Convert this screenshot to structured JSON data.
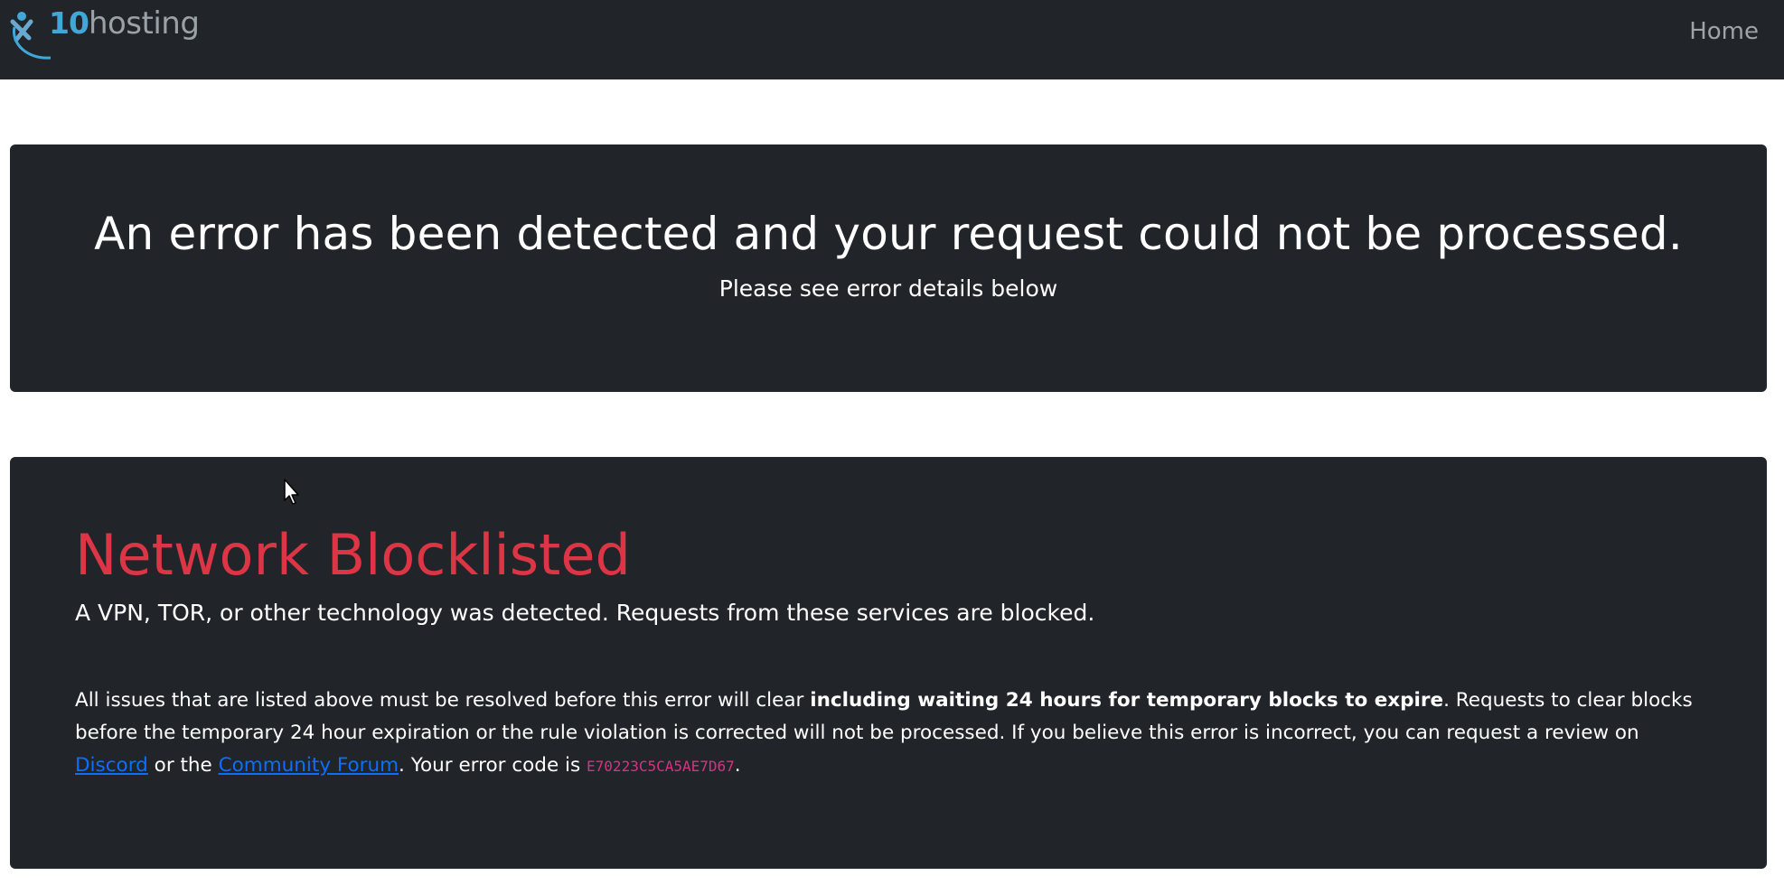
{
  "navbar": {
    "logo": {
      "num": "10",
      "word": "hosting",
      "colors": {
        "mark": "#41a7d9",
        "word": "#9aa1a7"
      }
    },
    "home_label": "Home"
  },
  "error_header": {
    "title": "An error has been detected and your request could not be processed.",
    "subtitle": "Please see error details below"
  },
  "error_detail": {
    "heading": "Network Blocklisted",
    "lead": "A VPN, TOR, or other technology was detected. Requests from these services are blocked.",
    "body_part1": "All issues that are listed above must be resolved before this error will clear ",
    "body_bold": "including waiting 24 hours for temporary blocks to expire",
    "body_part2": ". Requests to clear blocks before the temporary 24 hour expiration or the rule violation is corrected will not be processed. If you believe this error is incorrect, you can request a review on ",
    "discord_link": "Discord",
    "body_part3": " or the ",
    "forum_link": "Community Forum",
    "body_part4": ". Your error code is ",
    "error_code": "E70223C5CA5AE7D67",
    "body_part5": "."
  },
  "colors": {
    "dark": "#212529",
    "danger": "#dc3545",
    "link": "#0d6efd",
    "code": "#d63384"
  }
}
